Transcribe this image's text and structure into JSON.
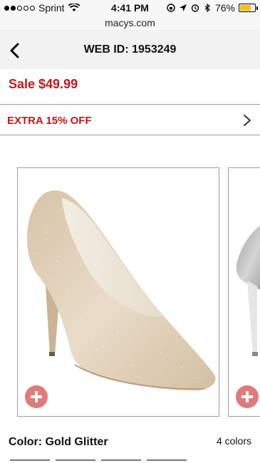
{
  "status_bar": {
    "carrier": "Sprint",
    "time": "4:41 PM",
    "battery": "76%",
    "battery_level": 0.76,
    "signal_dots_on": 2,
    "signal_dots_total": 5
  },
  "browser": {
    "url": "macys.com"
  },
  "header": {
    "title": "WEB ID: 1953249"
  },
  "product": {
    "price": "Sale $49.99",
    "promo": "EXTRA 15% OFF",
    "color_label": "Color: Gold Glitter",
    "colors_count": "4 colors"
  },
  "icons": {
    "back": "back-chevron-icon",
    "promo_chevron": "chevron-right-icon",
    "add": "plus-circle-icon"
  },
  "colors": {
    "sale_red": "#c4161c",
    "add_button": "#e07b7b",
    "battery": "#f2c300"
  }
}
